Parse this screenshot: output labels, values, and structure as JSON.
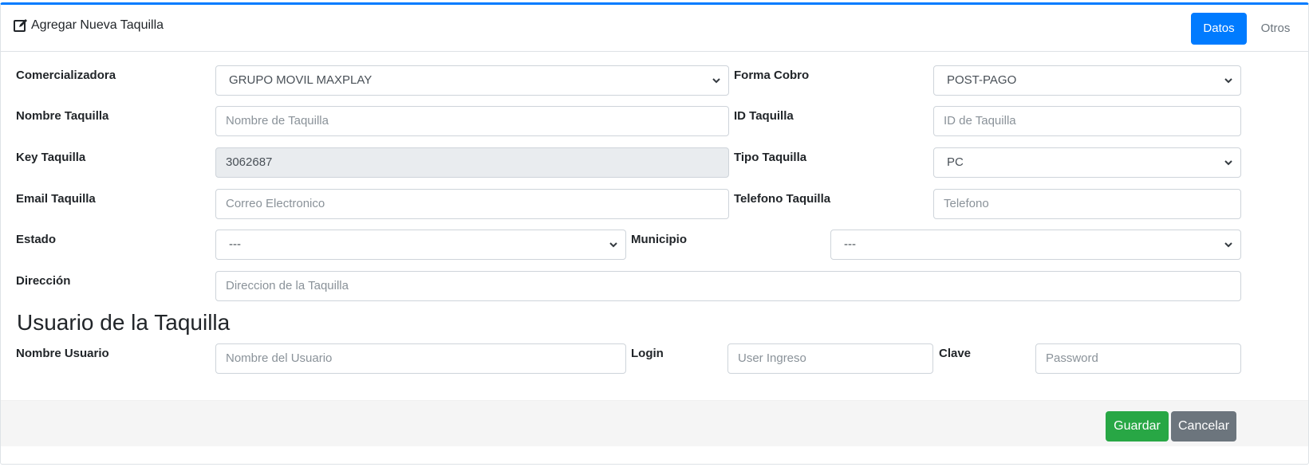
{
  "header": {
    "title": "Agregar Nueva Taquilla",
    "tabs": [
      {
        "label": "Datos",
        "active": true
      },
      {
        "label": "Otros",
        "active": false
      }
    ]
  },
  "form": {
    "comercializadora": {
      "label": "Comercializadora",
      "value": "GRUPO MOVIL MAXPLAY"
    },
    "forma_cobro": {
      "label": "Forma Cobro",
      "value": "POST-PAGO"
    },
    "nombre_taquilla": {
      "label": "Nombre Taquilla",
      "placeholder": "Nombre de Taquilla"
    },
    "id_taquilla": {
      "label": "ID Taquilla",
      "placeholder": "ID de Taquilla"
    },
    "key_taquilla": {
      "label": "Key Taquilla",
      "value": "3062687"
    },
    "tipo_taquilla": {
      "label": "Tipo Taquilla",
      "value": "PC"
    },
    "email_taquilla": {
      "label": "Email Taquilla",
      "placeholder": "Correo Electronico"
    },
    "telefono_taquilla": {
      "label": "Telefono Taquilla",
      "placeholder": "Telefono"
    },
    "estado": {
      "label": "Estado",
      "value": "---"
    },
    "municipio": {
      "label": "Municipio",
      "value": "---"
    },
    "direccion": {
      "label": "Dirección",
      "placeholder": "Direccion de la Taquilla"
    }
  },
  "user_section": {
    "title": "Usuario de la Taquilla",
    "nombre_usuario": {
      "label": "Nombre Usuario",
      "placeholder": "Nombre del Usuario"
    },
    "login": {
      "label": "Login",
      "placeholder": "User Ingreso"
    },
    "clave": {
      "label": "Clave",
      "placeholder": "Password"
    }
  },
  "footer": {
    "save_label": "Guardar",
    "cancel_label": "Cancelar"
  },
  "colors": {
    "primary": "#007bff",
    "success": "#28a745",
    "secondary": "#6c757d",
    "readonly_bg": "#e9ecef"
  },
  "icons": {
    "header_icon": "edit-icon",
    "select_icon": "chevron-down-icon"
  }
}
